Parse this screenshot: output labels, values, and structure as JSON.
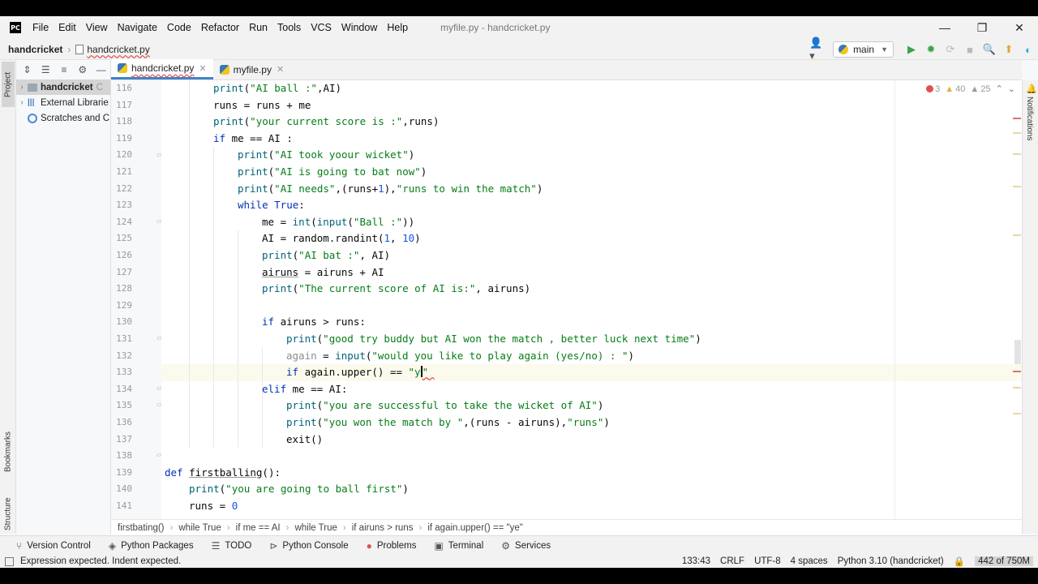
{
  "window": {
    "title": "myfile.py - handcricket.py",
    "menu": [
      "File",
      "Edit",
      "View",
      "Navigate",
      "Code",
      "Refactor",
      "Run",
      "Tools",
      "VCS",
      "Window",
      "Help"
    ]
  },
  "nav": {
    "project": "handcricket",
    "file": "handcricket.py",
    "branch": "main"
  },
  "left_strip": {
    "project_tab": "Project",
    "bookmarks_tab": "Bookmarks",
    "structure_tab": "Structure"
  },
  "right_strip": {
    "notifications_tab": "Notifications"
  },
  "project_tree": {
    "root": "handcricket",
    "root_suffix": "C",
    "libraries": "External Librarie",
    "scratches": "Scratches and C"
  },
  "editor": {
    "tabs": [
      {
        "label": "handcricket.py"
      },
      {
        "label": "myfile.py"
      }
    ],
    "inspections": {
      "errors": "3",
      "warnings": "40",
      "weak": "25"
    },
    "line_numbers": [
      "116",
      "117",
      "118",
      "119",
      "120",
      "121",
      "122",
      "123",
      "124",
      "125",
      "126",
      "127",
      "128",
      "129",
      "130",
      "131",
      "132",
      "133",
      "134",
      "135",
      "136",
      "137",
      "138",
      "139",
      "140",
      "141"
    ]
  },
  "breadcrumbs": [
    "firstbating()",
    "while True",
    "if me == AI",
    "while True",
    "if airuns > runs",
    "if again.upper() == \"ye\""
  ],
  "tool_windows": [
    {
      "label": "Version Control",
      "icon": "branch-icon"
    },
    {
      "label": "Python Packages",
      "icon": "package-icon"
    },
    {
      "label": "TODO",
      "icon": "list-icon"
    },
    {
      "label": "Python Console",
      "icon": "console-icon"
    },
    {
      "label": "Problems",
      "icon": "error-icon"
    },
    {
      "label": "Terminal",
      "icon": "terminal-icon"
    },
    {
      "label": "Services",
      "icon": "services-icon"
    }
  ],
  "status": {
    "message": "Expression expected. Indent expected.",
    "position": "133:43",
    "line_sep": "CRLF",
    "encoding": "UTF-8",
    "indent": "4 spaces",
    "interpreter": "Python 3.10 (handcricket)",
    "memory": "442 of 750M"
  }
}
